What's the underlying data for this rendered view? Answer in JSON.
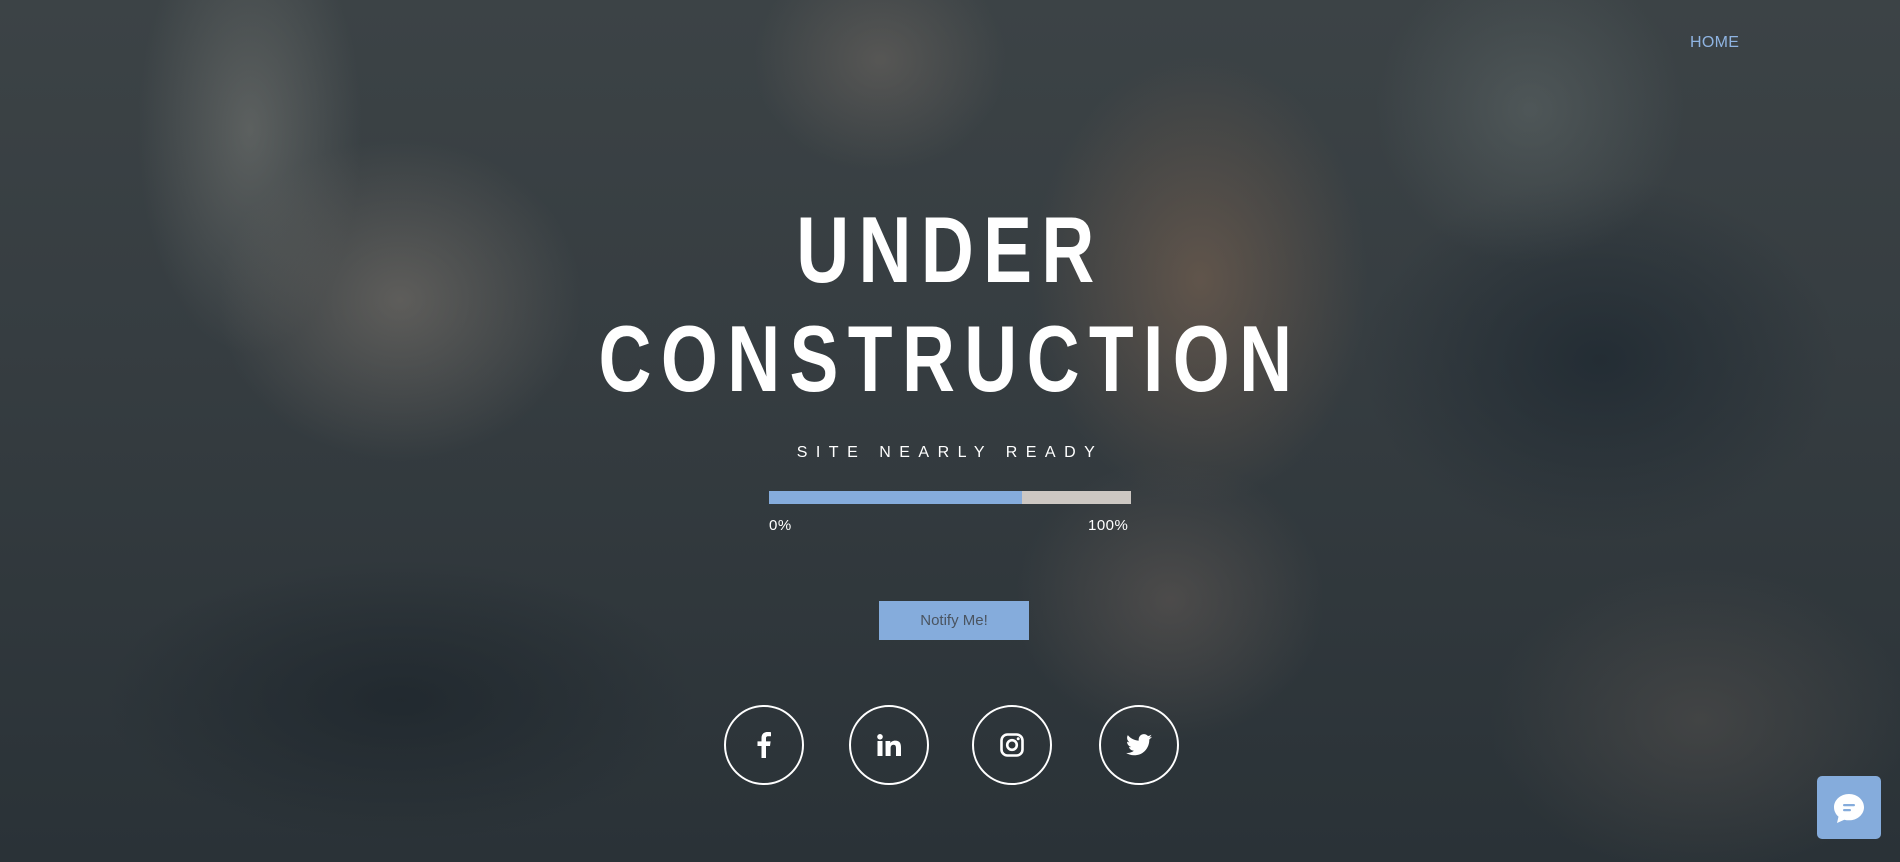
{
  "nav": {
    "home_label": "HOME"
  },
  "hero": {
    "title_line1": "UNDER",
    "title_line2": "CONSTRUCTION",
    "subtitle": "SITE NEARLY READY"
  },
  "progress": {
    "fraction": 0.7,
    "start_label": "0%",
    "end_label": "100%",
    "fill_color": "#85acdc",
    "track_color": "#cdc8c3"
  },
  "cta": {
    "notify_label": "Notify Me!"
  },
  "social": [
    "facebook-icon",
    "linkedin-icon",
    "instagram-icon",
    "twitter-icon"
  ],
  "chat": {
    "icon": "chat-icon"
  },
  "colors": {
    "accent": "#85acdc",
    "nav_link": "#8fb4e2",
    "text": "#ffffff"
  }
}
